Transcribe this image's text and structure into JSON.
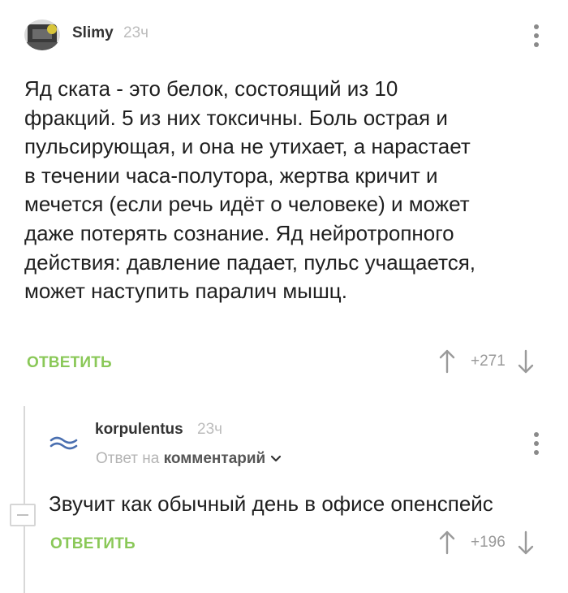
{
  "comment1": {
    "author": "Slimy",
    "time": "23ч",
    "text_lines": [
      "Яд ската - это белок, состоящий из 10",
      "фракций. 5 из них токсичны. Боль острая и",
      "пульсирующая, и она не утихает, а нарастает",
      "в течении часа-полутора, жертва кричит и",
      "мечется (если речь идёт о человеке) и может",
      "даже потерять сознание. Яд нейротропного",
      "действия: давление падает, пульс учащается,",
      "может наступить паралич мышц."
    ],
    "reply_label": "ОТВЕТИТЬ",
    "score": "+271"
  },
  "comment2": {
    "author": "korpulentus",
    "time": "23ч",
    "reply_to_prefix": "Ответ на",
    "reply_to_link": "комментарий",
    "text": "Звучит как обычный день в офисе опенспейс",
    "reply_label": "ОТВЕТИТЬ",
    "score": "+196"
  },
  "colors": {
    "accent_green": "#8ac858",
    "avatar_wave": "#4a6fb0"
  },
  "icons": [
    "avatar",
    "more-vertical-icon",
    "arrow-up-icon",
    "arrow-down-icon",
    "chevron-down-icon",
    "collapse-icon",
    "wave-avatar-icon"
  ]
}
